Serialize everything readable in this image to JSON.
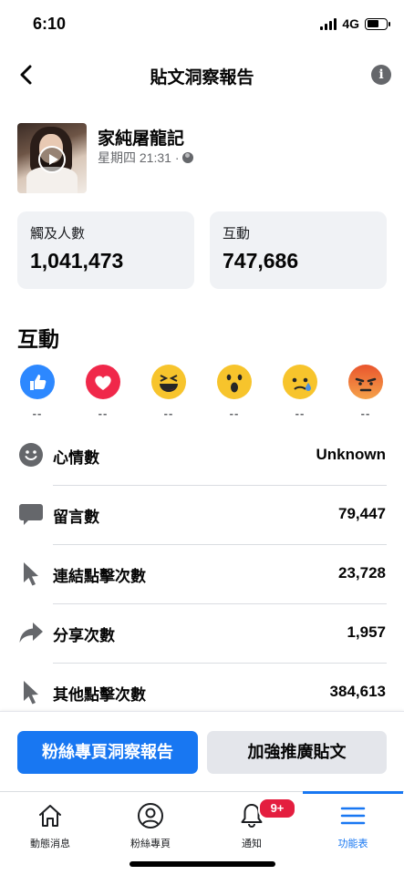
{
  "status_bar": {
    "time": "6:10",
    "network": "4G"
  },
  "header": {
    "title": "貼文洞察報告"
  },
  "post": {
    "title": "家純屠龍記",
    "meta": "星期四 21:31 ·"
  },
  "metrics": {
    "reach_label": "觸及人數",
    "reach_value": "1,041,473",
    "engagement_label": "互動",
    "engagement_value": "747,686"
  },
  "section": {
    "title": "互動"
  },
  "reactions": [
    {
      "name": "like",
      "value": "--",
      "color": "#2d88ff"
    },
    {
      "name": "love",
      "value": "--",
      "color": "#f0284a"
    },
    {
      "name": "haha",
      "value": "--",
      "color": "#f7c42c"
    },
    {
      "name": "wow",
      "value": "--",
      "color": "#f7c42c"
    },
    {
      "name": "sad",
      "value": "--",
      "color": "#f7c42c"
    },
    {
      "name": "angry",
      "value": "--",
      "color": "#e9552d"
    }
  ],
  "stats": [
    {
      "icon": "smiley-icon",
      "label": "心情數",
      "value": "Unknown"
    },
    {
      "icon": "comment-icon",
      "label": "留言數",
      "value": "79,447"
    },
    {
      "icon": "cursor-icon",
      "label": "連結點擊次數",
      "value": "23,728"
    },
    {
      "icon": "share-icon",
      "label": "分享次數",
      "value": "1,957"
    },
    {
      "icon": "cursor-icon",
      "label": "其他點擊次數",
      "value": "384,613"
    }
  ],
  "actions": {
    "primary": "粉絲專頁洞察報告",
    "secondary": "加強推廣貼文"
  },
  "tabs": [
    {
      "icon": "home-icon",
      "label": "動態消息"
    },
    {
      "icon": "profile-icon",
      "label": "粉絲專頁"
    },
    {
      "icon": "bell-icon",
      "label": "通知",
      "badge": "9+"
    },
    {
      "icon": "menu-icon",
      "label": "功能表"
    }
  ],
  "colors": {
    "accent": "#1877f2",
    "badge": "#e41e3f",
    "card_bg": "#f0f2f5"
  }
}
